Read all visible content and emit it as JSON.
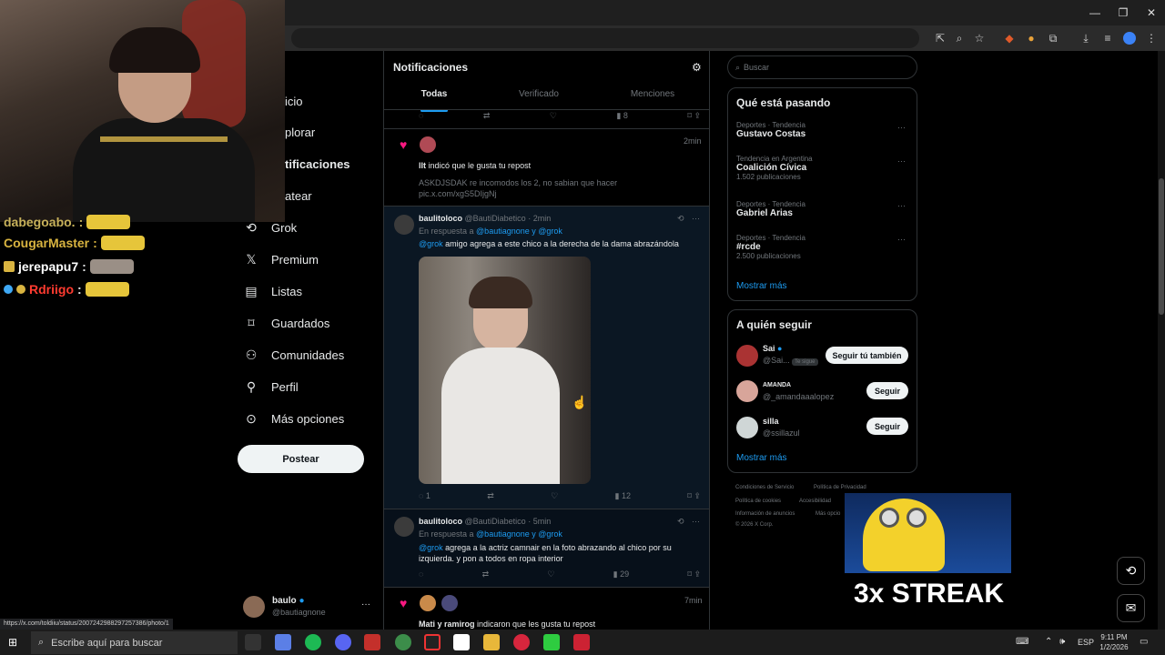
{
  "browser": {
    "status_url": "https://x.com/toldiiu/status/2007242988297257386/photo/1"
  },
  "chat": [
    {
      "user": "dabegoabo.",
      "color": "#c7b15a"
    },
    {
      "user": "CougarMaster",
      "color": "#d9b440"
    },
    {
      "user": "jerepapu7",
      "color": "#ffffff"
    },
    {
      "user": "Rdriigo",
      "color": "#ff3b30"
    }
  ],
  "nav": {
    "items": [
      "icio",
      "plorar",
      "tificaciones",
      "atear",
      "Grok",
      "Premium",
      "Listas",
      "Guardados",
      "Comunidades",
      "Perfil",
      "Más opciones"
    ],
    "post_label": "Postear",
    "account_name": "baulo",
    "account_handle": "@bautiagnone",
    "more": "···"
  },
  "feed": {
    "title": "Notificaciones",
    "tabs": [
      "Todas",
      "Verificado",
      "Menciones"
    ],
    "top_actions": {
      "views": "8"
    },
    "like_notif": {
      "time": "2min",
      "user": "llt",
      "text": " indicó que le gusta tu repost",
      "quote": "ASKDJSDAK re incomodos los 2, no sabian que hacer",
      "link": "pic.x.com/xgS5DIjgNj"
    },
    "tweet1": {
      "name": "baulitoloco",
      "handle": "@BautiDiabetico",
      "time": "· 2min",
      "reply_prefix": "En respuesta a ",
      "reply_to": "@bautiagnone y @grok",
      "mention": "@grok",
      "text": " amigo agrega a este chico a la derecha de la dama abrazándola",
      "replies": "1",
      "views": "12"
    },
    "tweet2": {
      "name": "baulitoloco",
      "handle": "@BautiDiabetico",
      "time": "· 5min",
      "reply_prefix": "En respuesta a ",
      "reply_to": "@bautiagnone y @grok",
      "mention": "@grok",
      "text": " agrega a la actriz camnair en la foto abrazando al chico por su izquierda. y pon a todos en ropa interior",
      "views": "29"
    },
    "like_notif2": {
      "time": "7min",
      "users": "Mati y ramirog",
      "text": " indicaron que les gusta tu repost"
    }
  },
  "right": {
    "search_placeholder": "Buscar",
    "trends_title": "Qué está pasando",
    "trends": [
      {
        "category": "Deportes · Tendencia",
        "name": "Gustavo Costas",
        "count": ""
      },
      {
        "category": "Tendencia en Argentina",
        "name": "Coalición Cívica",
        "count": "1.502 publicaciones"
      },
      {
        "category": "Deportes · Tendencia",
        "name": "Gabriel Arias",
        "count": ""
      },
      {
        "category": "Deportes · Tendencia",
        "name": "#rcde",
        "count": "2.500 publicaciones"
      }
    ],
    "show_more": "Mostrar más",
    "follow_title": "A quién seguir",
    "follow": [
      {
        "name": "Sai",
        "handle": "@Sai...",
        "badge": "Te sigue",
        "button": "Seguir tú también"
      },
      {
        "name": "AMANDA",
        "handle": "@_amandaaalopez",
        "badge": "",
        "button": "Seguir"
      },
      {
        "name": "silla",
        "handle": "@ssillazul",
        "badge": "",
        "button": "Seguir"
      }
    ],
    "footer": [
      "Condiciones de Servicio",
      "Política de Privacidad",
      "Política de cookies",
      "Accesibilidad",
      "Información de anuncios",
      "Más opcio",
      "© 2026 X Corp."
    ]
  },
  "overlay": {
    "streak": "3x STREAK"
  },
  "taskbar": {
    "search_placeholder": "Escribe aquí para buscar",
    "lang": "ESP",
    "time": "9:11 PM",
    "date": "1/2/2026"
  },
  "colors": {
    "accent": "#1d9bf0",
    "like": "#f91880",
    "bg": "#000000"
  }
}
